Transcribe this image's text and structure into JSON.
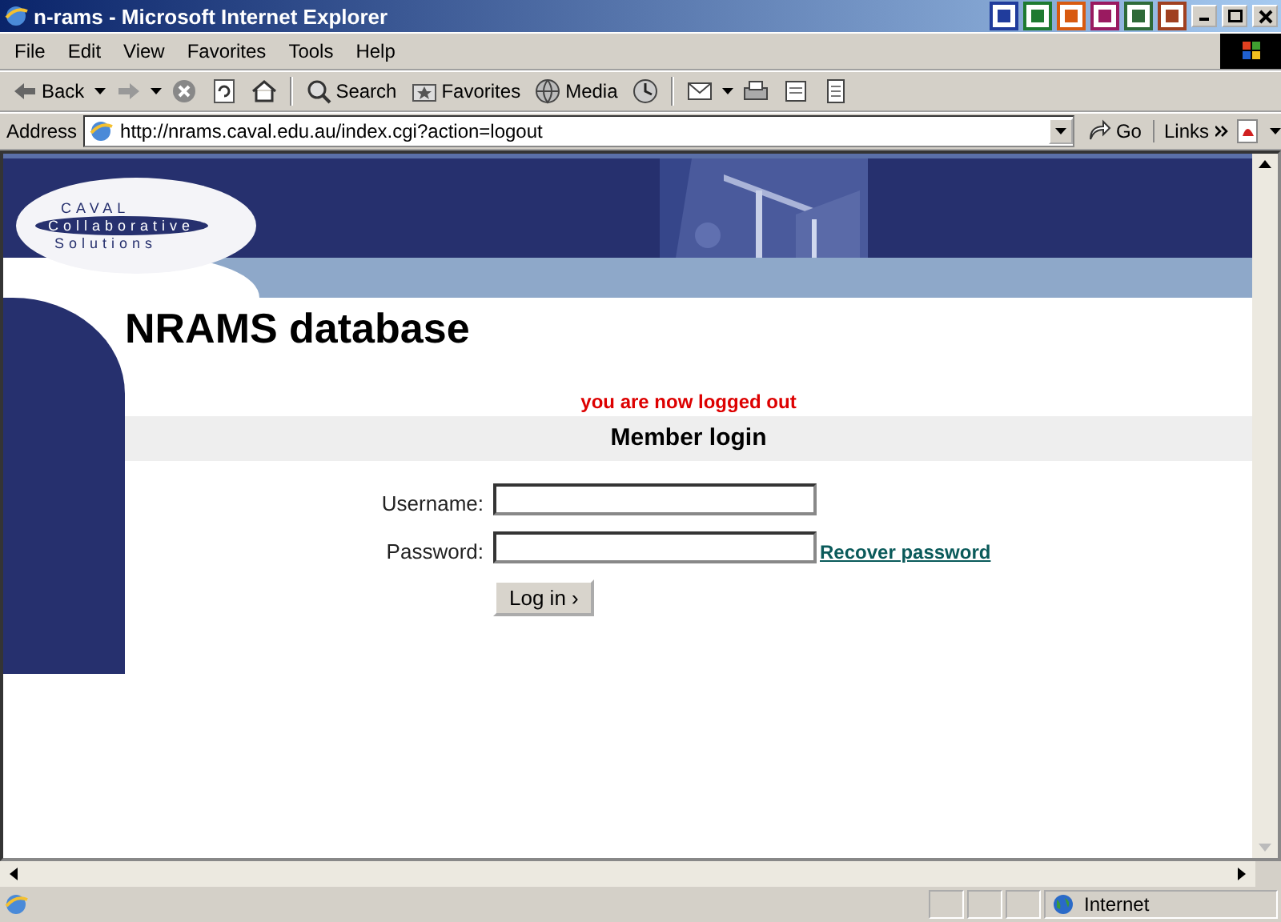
{
  "window": {
    "title": "n-rams - Microsoft Internet Explorer"
  },
  "menu": [
    "File",
    "Edit",
    "View",
    "Favorites",
    "Tools",
    "Help"
  ],
  "toolbar": [
    {
      "kind": "back",
      "label": "Back"
    },
    {
      "kind": "forward"
    },
    {
      "kind": "stop"
    },
    {
      "kind": "refresh"
    },
    {
      "kind": "home"
    },
    {
      "kind": "search",
      "label": "Search"
    },
    {
      "kind": "favorites",
      "label": "Favorites"
    },
    {
      "kind": "media",
      "label": "Media"
    },
    {
      "kind": "history"
    },
    {
      "kind": "mail"
    },
    {
      "kind": "print"
    },
    {
      "kind": "edit"
    },
    {
      "kind": "discuss"
    }
  ],
  "address": {
    "label": "Address",
    "url": "http://nrams.caval.edu.au/index.cgi?action=logout",
    "go": "Go",
    "links": "Links"
  },
  "page": {
    "logo": [
      "CAVAL",
      "Collaborative",
      "Solutions"
    ],
    "heading": "NRAMS database",
    "message": "you are now logged out",
    "section_title": "Member login",
    "fields": [
      {
        "label": "Username:"
      },
      {
        "label": "Password:",
        "link": "Recover password"
      }
    ],
    "submit": "Log in ›"
  },
  "status_bar": {
    "zone": "Internet"
  }
}
